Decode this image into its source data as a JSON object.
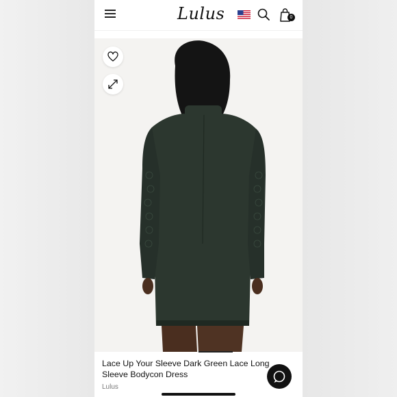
{
  "header": {
    "logo_text": "Lulus",
    "cart_count": "0",
    "icons": [
      "menu-icon",
      "us-flag-icon",
      "search-icon",
      "shopping-bag-icon"
    ]
  },
  "product_image": {
    "icons": [
      "heart-icon",
      "expand-icon"
    ]
  },
  "product": {
    "title": "Lace Up Your Sleeve Dark Green Lace Long Sleeve Bodycon Dress",
    "brand": "Lulus"
  },
  "chat": {
    "icon": "chat-icon"
  },
  "colors": {
    "dress": "#2c372f",
    "dress_shadow": "#1f2922",
    "hair": "#141414",
    "skin": "#5a3a28",
    "photo_bg": "#f5f4f2",
    "text": "#111111",
    "muted": "#777777"
  }
}
